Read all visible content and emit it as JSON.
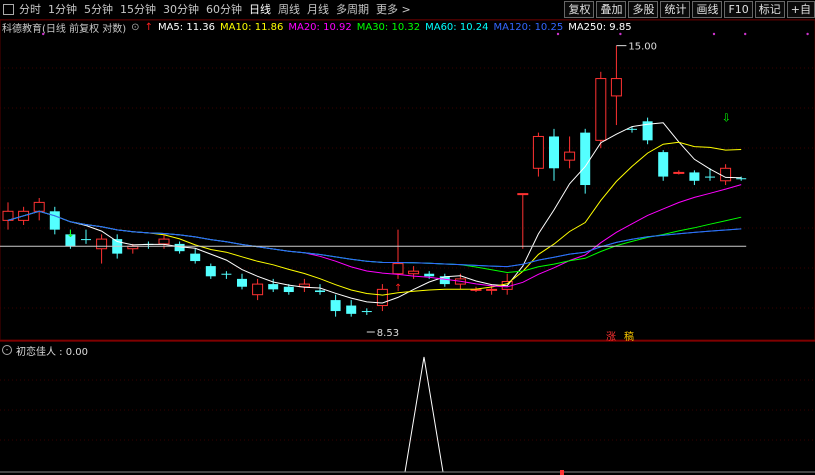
{
  "toolbar": {
    "periods": [
      "分时",
      "1分钟",
      "5分钟",
      "15分钟",
      "30分钟",
      "60分钟",
      "日线",
      "周线",
      "月线",
      "多周期",
      "更多 >"
    ],
    "active_period": "日线",
    "right_buttons": [
      "复权",
      "叠加",
      "多股",
      "统计",
      "画线",
      "F10",
      "标记",
      "+自"
    ]
  },
  "stock": {
    "title": "科德教育(日线 前复权 对数)",
    "ma_items": [
      {
        "label": "MA5: 11.36",
        "color": "#ffffff"
      },
      {
        "label": "MA10: 11.86",
        "color": "#ffff00"
      },
      {
        "label": "MA20: 10.92",
        "color": "#ff00ff"
      },
      {
        "label": "MA30: 10.32",
        "color": "#00ff00"
      },
      {
        "label": "MA60: 10.24",
        "color": "#00ffff"
      },
      {
        "label": "MA120: 10.25",
        "color": "#3366ff"
      },
      {
        "label": "MA250: 9.85",
        "color": "#ffffff"
      }
    ]
  },
  "annotations": {
    "high_label": "15.00",
    "low_label": "8.53",
    "zhangting_label": "涨",
    "tag_label": "稿"
  },
  "indicator": {
    "title": "初恋佳人 : 0.00"
  },
  "chart_data": {
    "type": "candlestick",
    "y_scale": "log",
    "high_marker": 15.0,
    "low_marker": 8.53,
    "candles": [
      {
        "o": 10.6,
        "h": 10.8,
        "l": 10.2,
        "c": 10.4,
        "up": true
      },
      {
        "o": 10.4,
        "h": 10.7,
        "l": 10.3,
        "c": 10.6,
        "up": true
      },
      {
        "o": 10.6,
        "h": 10.9,
        "l": 10.4,
        "c": 10.8,
        "up": true
      },
      {
        "o": 10.6,
        "h": 10.7,
        "l": 10.1,
        "c": 10.2,
        "up": false
      },
      {
        "o": 10.1,
        "h": 10.2,
        "l": 9.8,
        "c": 9.85,
        "up": false
      },
      {
        "o": 10.0,
        "h": 10.2,
        "l": 9.9,
        "c": 10.0,
        "up": false
      },
      {
        "o": 9.8,
        "h": 10.1,
        "l": 9.5,
        "c": 10.0,
        "up": true
      },
      {
        "o": 10.0,
        "h": 10.1,
        "l": 9.6,
        "c": 9.7,
        "up": false
      },
      {
        "o": 9.8,
        "h": 9.9,
        "l": 9.7,
        "c": 9.85,
        "up": true
      },
      {
        "o": 9.9,
        "h": 9.95,
        "l": 9.8,
        "c": 9.9,
        "up": false
      },
      {
        "o": 9.9,
        "h": 10.1,
        "l": 9.8,
        "c": 10.0,
        "up": true
      },
      {
        "o": 9.9,
        "h": 9.95,
        "l": 9.7,
        "c": 9.75,
        "up": false
      },
      {
        "o": 9.7,
        "h": 9.8,
        "l": 9.5,
        "c": 9.55,
        "up": false
      },
      {
        "o": 9.45,
        "h": 9.5,
        "l": 9.2,
        "c": 9.25,
        "up": false
      },
      {
        "o": 9.3,
        "h": 9.35,
        "l": 9.2,
        "c": 9.3,
        "up": false
      },
      {
        "o": 9.2,
        "h": 9.3,
        "l": 9.0,
        "c": 9.05,
        "up": false
      },
      {
        "o": 8.9,
        "h": 9.2,
        "l": 8.8,
        "c": 9.1,
        "up": true
      },
      {
        "o": 9.1,
        "h": 9.2,
        "l": 8.95,
        "c": 9.0,
        "up": false
      },
      {
        "o": 9.05,
        "h": 9.1,
        "l": 8.9,
        "c": 8.95,
        "up": false
      },
      {
        "o": 9.05,
        "h": 9.2,
        "l": 8.95,
        "c": 9.1,
        "up": true
      },
      {
        "o": 8.95,
        "h": 9.1,
        "l": 8.9,
        "c": 8.98,
        "up": false
      },
      {
        "o": 8.8,
        "h": 8.9,
        "l": 8.5,
        "c": 8.6,
        "up": false
      },
      {
        "o": 8.7,
        "h": 8.8,
        "l": 8.5,
        "c": 8.55,
        "up": false
      },
      {
        "o": 8.6,
        "h": 8.65,
        "l": 8.53,
        "c": 8.6,
        "up": false
      },
      {
        "o": 8.7,
        "h": 9.1,
        "l": 8.6,
        "c": 9.0,
        "up": true
      },
      {
        "o": 9.3,
        "h": 10.2,
        "l": 9.2,
        "c": 9.5,
        "up": true
      },
      {
        "o": 9.3,
        "h": 9.45,
        "l": 9.2,
        "c": 9.35,
        "up": true
      },
      {
        "o": 9.3,
        "h": 9.35,
        "l": 9.2,
        "c": 9.25,
        "up": false
      },
      {
        "o": 9.25,
        "h": 9.3,
        "l": 9.05,
        "c": 9.1,
        "up": false
      },
      {
        "o": 9.2,
        "h": 9.3,
        "l": 9.0,
        "c": 9.1,
        "up": true
      },
      {
        "o": 9.0,
        "h": 9.05,
        "l": 8.95,
        "c": 9.0,
        "up": true
      },
      {
        "o": 9.0,
        "h": 9.1,
        "l": 8.9,
        "c": 9.0,
        "up": true
      },
      {
        "o": 9.0,
        "h": 9.3,
        "l": 8.9,
        "c": 9.15,
        "up": true
      },
      {
        "o": 11.0,
        "h": 11.0,
        "l": 9.8,
        "c": 11.0,
        "up": true
      },
      {
        "o": 11.6,
        "h": 12.5,
        "l": 11.4,
        "c": 12.4,
        "up": true
      },
      {
        "o": 12.4,
        "h": 12.6,
        "l": 11.3,
        "c": 11.6,
        "up": false
      },
      {
        "o": 11.8,
        "h": 12.4,
        "l": 11.6,
        "c": 12.0,
        "up": true
      },
      {
        "o": 12.5,
        "h": 12.6,
        "l": 11.0,
        "c": 11.2,
        "up": false
      },
      {
        "o": 12.3,
        "h": 14.2,
        "l": 12.1,
        "c": 14.0,
        "up": true
      },
      {
        "o": 14.0,
        "h": 15.0,
        "l": 12.7,
        "c": 13.5,
        "up": true
      },
      {
        "o": 12.6,
        "h": 12.65,
        "l": 12.5,
        "c": 12.6,
        "up": false
      },
      {
        "o": 12.8,
        "h": 12.9,
        "l": 12.2,
        "c": 12.3,
        "up": false
      },
      {
        "o": 12.0,
        "h": 12.05,
        "l": 11.3,
        "c": 11.4,
        "up": false
      },
      {
        "o": 11.5,
        "h": 11.55,
        "l": 11.45,
        "c": 11.5,
        "up": true
      },
      {
        "o": 11.5,
        "h": 11.55,
        "l": 11.2,
        "c": 11.3,
        "up": false
      },
      {
        "o": 11.4,
        "h": 11.6,
        "l": 11.3,
        "c": 11.4,
        "up": false
      },
      {
        "o": 11.6,
        "h": 11.7,
        "l": 11.2,
        "c": 11.3,
        "up": true
      },
      {
        "o": 11.36,
        "h": 11.4,
        "l": 11.3,
        "c": 11.36,
        "up": false
      }
    ],
    "indicator_values": "spike to 1 near the 25th bar, 0 elsewhere"
  }
}
